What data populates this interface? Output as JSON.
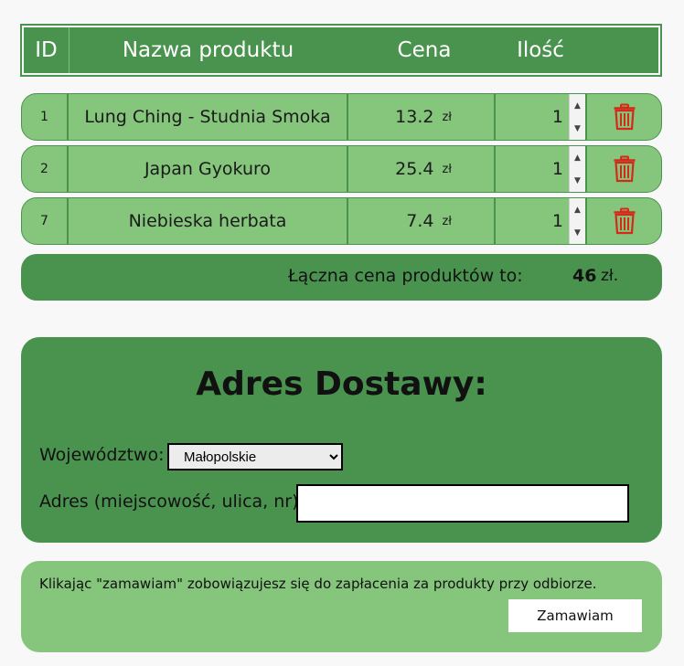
{
  "table": {
    "headers": {
      "id": "ID",
      "name": "Nazwa produktu",
      "price": "Cena",
      "qty": "Ilość"
    },
    "rows": [
      {
        "id": "1",
        "name": "Lung Ching - Studnia Smoka",
        "price": "13.2",
        "currency": "zł",
        "qty": "1"
      },
      {
        "id": "2",
        "name": "Japan Gyokuro",
        "price": "25.4",
        "currency": "zł",
        "qty": "1"
      },
      {
        "id": "7",
        "name": "Niebieska herbata",
        "price": "7.4",
        "currency": "zł",
        "qty": "1"
      }
    ],
    "row_icon": "trash-icon"
  },
  "total": {
    "label": "Łączna cena produktów to:",
    "amount": "46",
    "currency": "zł."
  },
  "address": {
    "title": "Adres Dostawy:",
    "voivodeship_label": "Województwo:",
    "voivodeship_selected": "Małopolskie",
    "address_label": "Adres (miejscowość, ulica, nr):",
    "address_value": ""
  },
  "order": {
    "note": "Klikając \"zamawiam\" zobowiązujesz się do zapłacenia za produkty przy odbiorze.",
    "button_label": "Zamawiam"
  },
  "colors": {
    "dark_green": "#4a934f",
    "light_green": "#85c57c",
    "trash_red": "#d42a1a"
  }
}
